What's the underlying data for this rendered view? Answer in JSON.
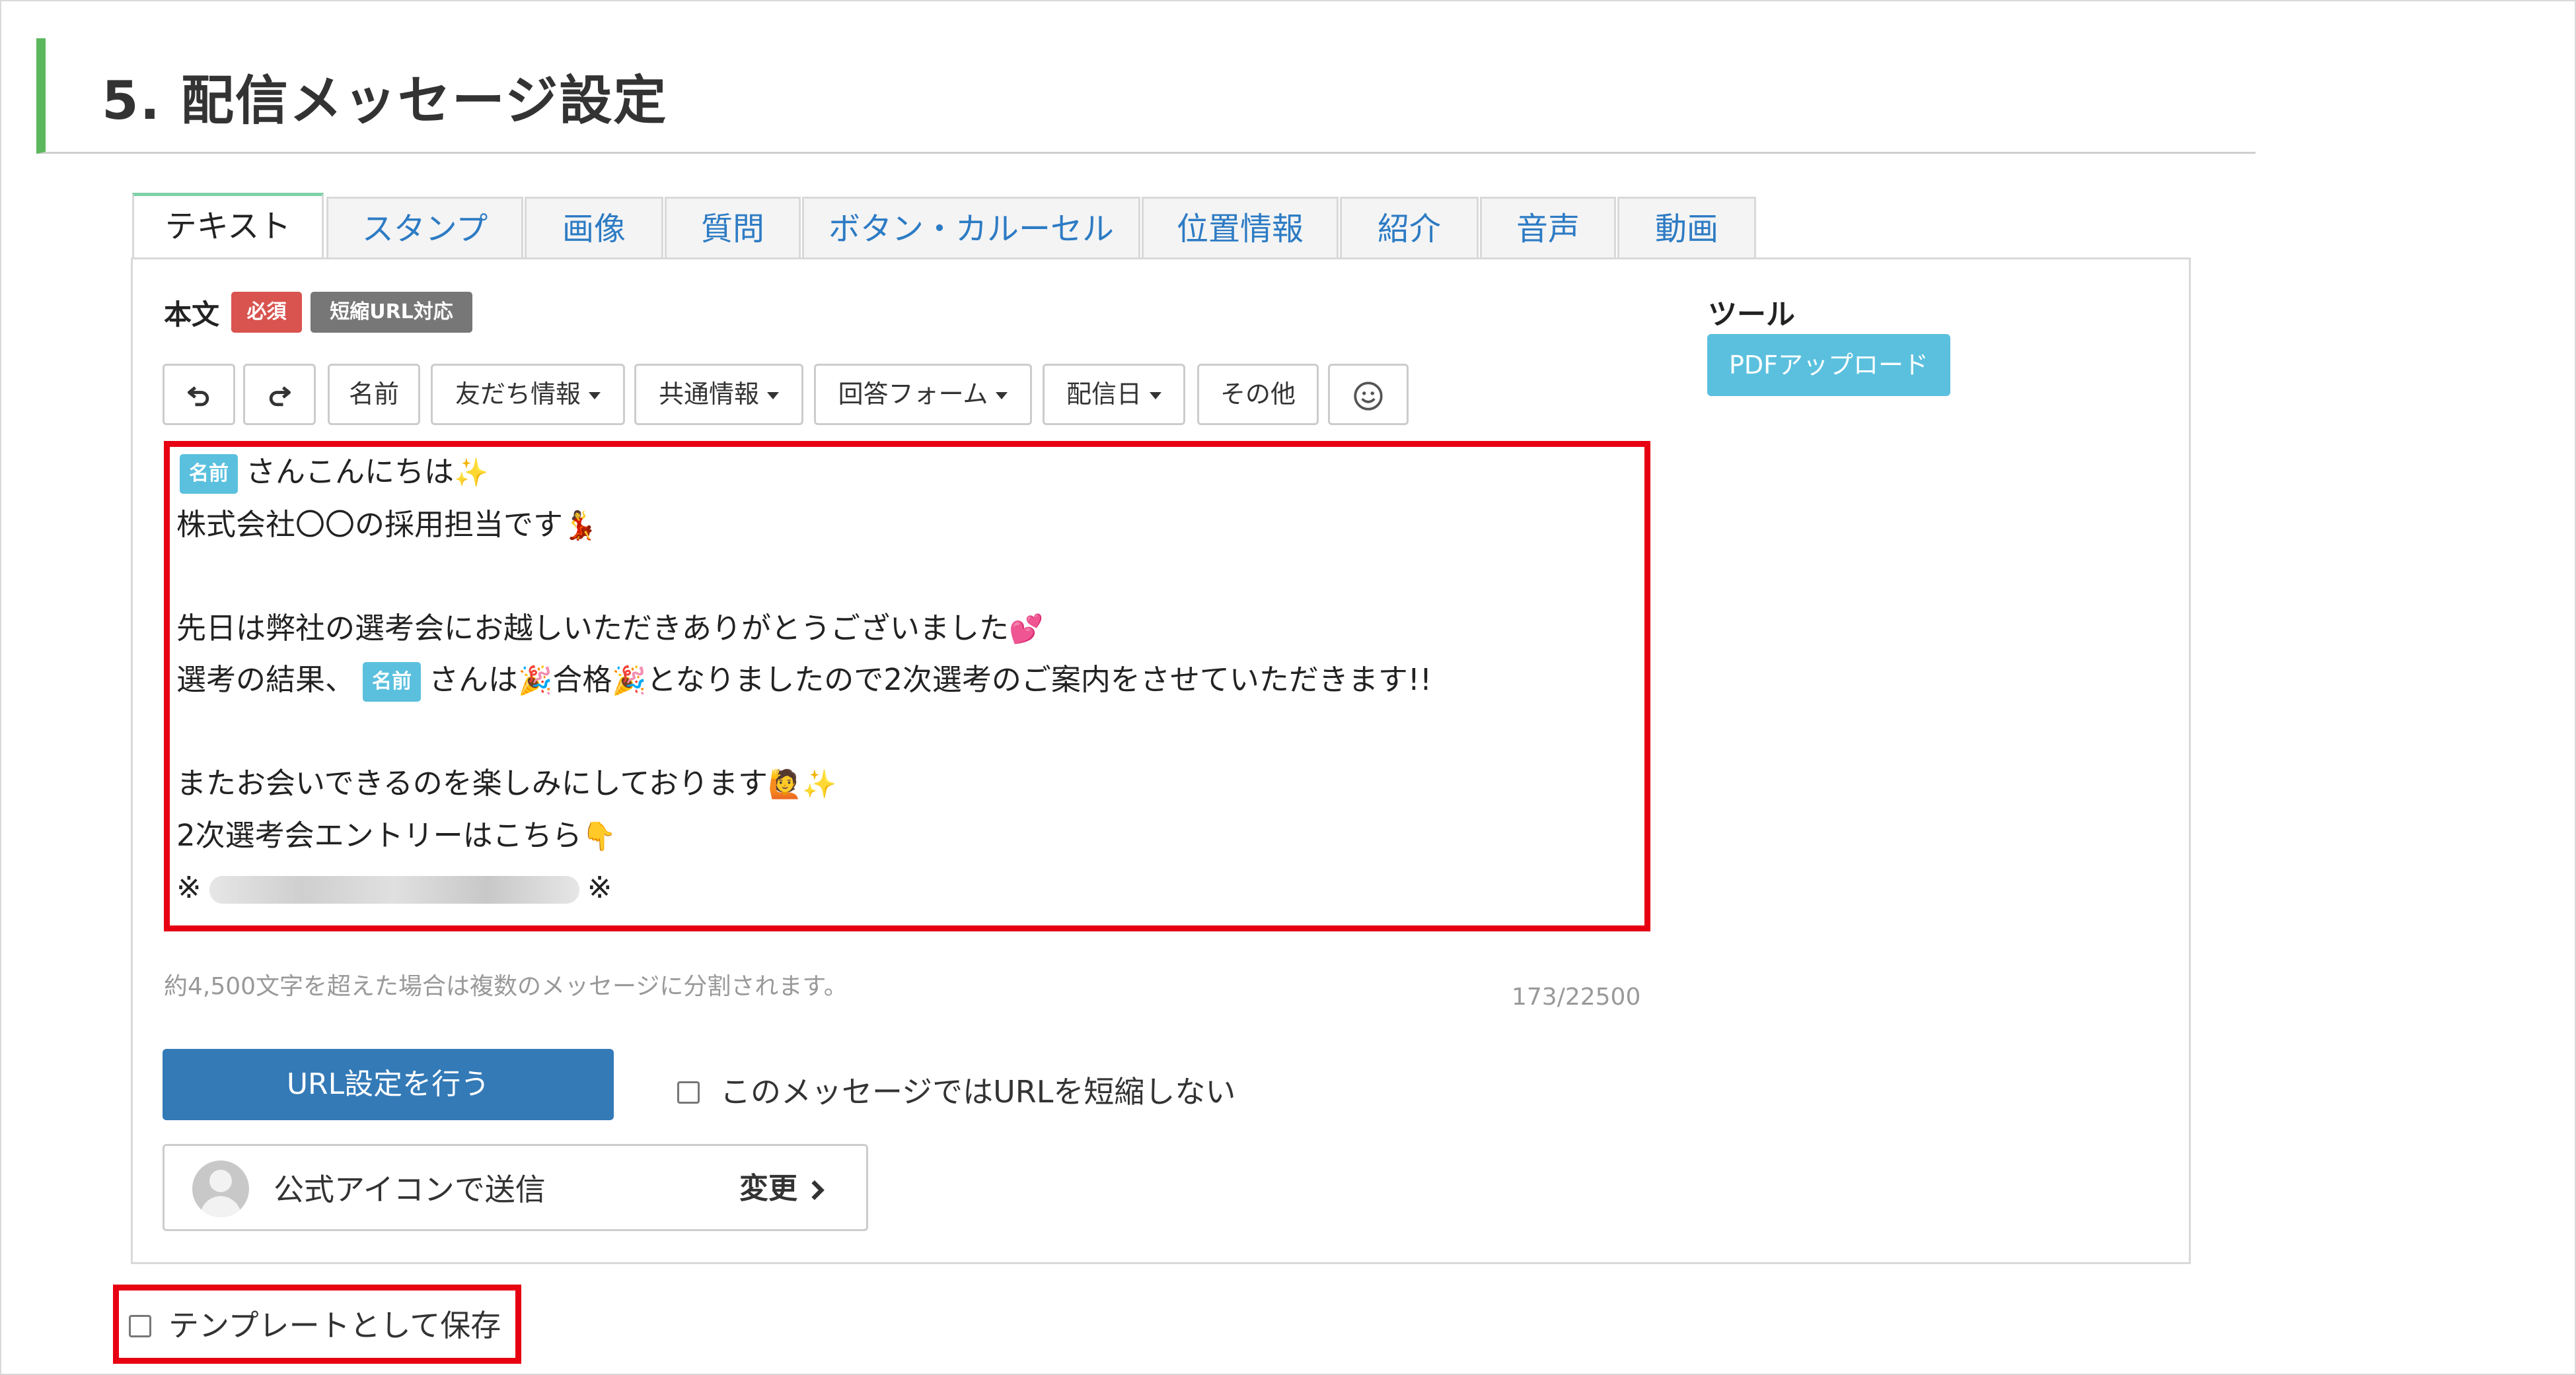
{
  "section": {
    "title": "5. 配信メッセージ設定"
  },
  "tabs": [
    {
      "label": "テキスト",
      "active": true
    },
    {
      "label": "スタンプ"
    },
    {
      "label": "画像"
    },
    {
      "label": "質問"
    },
    {
      "label": "ボタン・カルーセル"
    },
    {
      "label": "位置情報"
    },
    {
      "label": "紹介"
    },
    {
      "label": "音声"
    },
    {
      "label": "動画"
    }
  ],
  "body_section": {
    "label": "本文",
    "required_badge": "必須",
    "short_url_badge": "短縮URL対応"
  },
  "tools": {
    "label": "ツール",
    "pdf_upload": "PDFアップロード"
  },
  "toolbar": {
    "undo_icon": "undo-icon",
    "redo_icon": "redo-icon",
    "name": "名前",
    "friend_info": "友だち情報",
    "common_info": "共通情報",
    "answer_form": "回答フォーム",
    "delivery_date": "配信日",
    "other": "その他",
    "emoji_icon": "smiley-icon"
  },
  "editor": {
    "name_chip": "名前",
    "line1_text": "さんこんにちは",
    "line2_text": "株式会社〇〇の採用担当です",
    "line4_text": "先日は弊社の選考会にお越しいただきありがとうございました",
    "line5_pre": "選考の結果、",
    "line5_mid1": "さんは",
    "line5_mid2": "合格",
    "line5_post": "となりましたので2次選考のご案内をさせていただきます!!",
    "line7_text": "またお会いできるのを楽しみにしております",
    "line8_text": "2次選考会エントリーはこちら",
    "line9_mark": "※",
    "emoji_sparkles": "✨",
    "emoji_dancer": "💃",
    "emoji_hearts": "💕",
    "emoji_party": "🎉",
    "emoji_raise_hand": "🙋",
    "emoji_point_down": "👇"
  },
  "note": "約4,500文字を超えた場合は複数のメッセージに分割されます。",
  "counter": "173/22500",
  "url_button": "URL設定を行う",
  "no_shorten_checkbox": {
    "label": "このメッセージではURLを短縮しない",
    "checked": false
  },
  "sender": {
    "label": "公式アイコンで送信",
    "change": "変更"
  },
  "save_template_checkbox": {
    "label": "テンプレートとして保存",
    "checked": false
  }
}
